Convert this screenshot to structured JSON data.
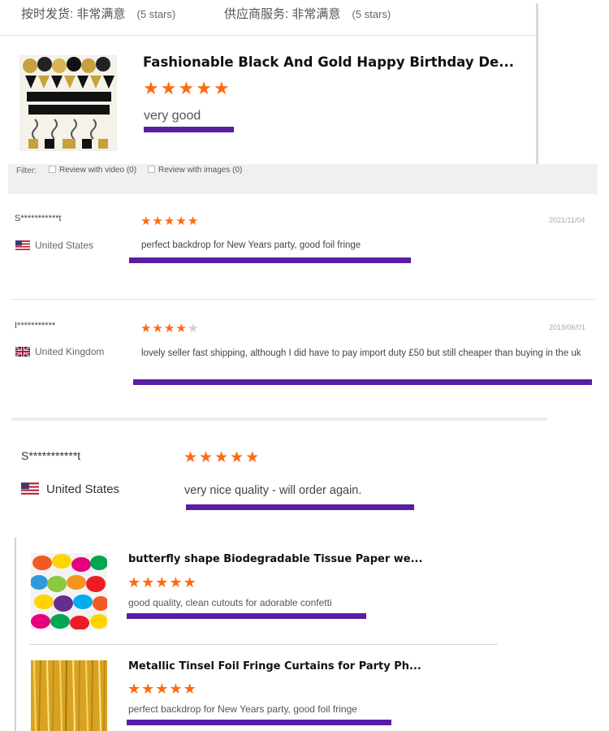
{
  "seller_ratings": [
    {
      "label": "按时发货:",
      "value": "非常满意",
      "stars_text": "(5 stars)"
    },
    {
      "label": "供应商服务:",
      "value": "非常满意",
      "stars_text": "(5 stars)"
    }
  ],
  "product_card": {
    "title": "Fashionable Black And Gold Happy Birthday De...",
    "rating": 5,
    "review": "very good"
  },
  "filter_bar": {
    "label": "Filter:",
    "options": [
      "Review with video (0)",
      "Review with images (0)"
    ]
  },
  "reviews": [
    {
      "user": "S***********t",
      "country": "United States",
      "date": "2021/11/04",
      "rating": 5,
      "text": "perfect backdrop for New Years party, good foil fringe"
    },
    {
      "user": "I***********",
      "country": "United Kingdom",
      "date": "2019/06/01",
      "rating": 4,
      "text": "lovely seller fast shipping, although I did have to pay import duty £50 but still cheaper than buying in the uk"
    },
    {
      "user": "S***********t",
      "country": "United States",
      "rating": 5,
      "text": "very nice quality - will order again."
    }
  ],
  "related": [
    {
      "title": "butterfly shape Biodegradable Tissue Paper we...",
      "rating": 5,
      "review": "good quality, clean cutouts for adorable confetti"
    },
    {
      "title": "Metallic Tinsel Foil Fringe Curtains for Party Ph...",
      "rating": 5,
      "review": "perfect backdrop for New Years party, good foil fringe"
    }
  ],
  "colors": {
    "star": "#ff6a10",
    "underline": "#5a1ea5"
  }
}
